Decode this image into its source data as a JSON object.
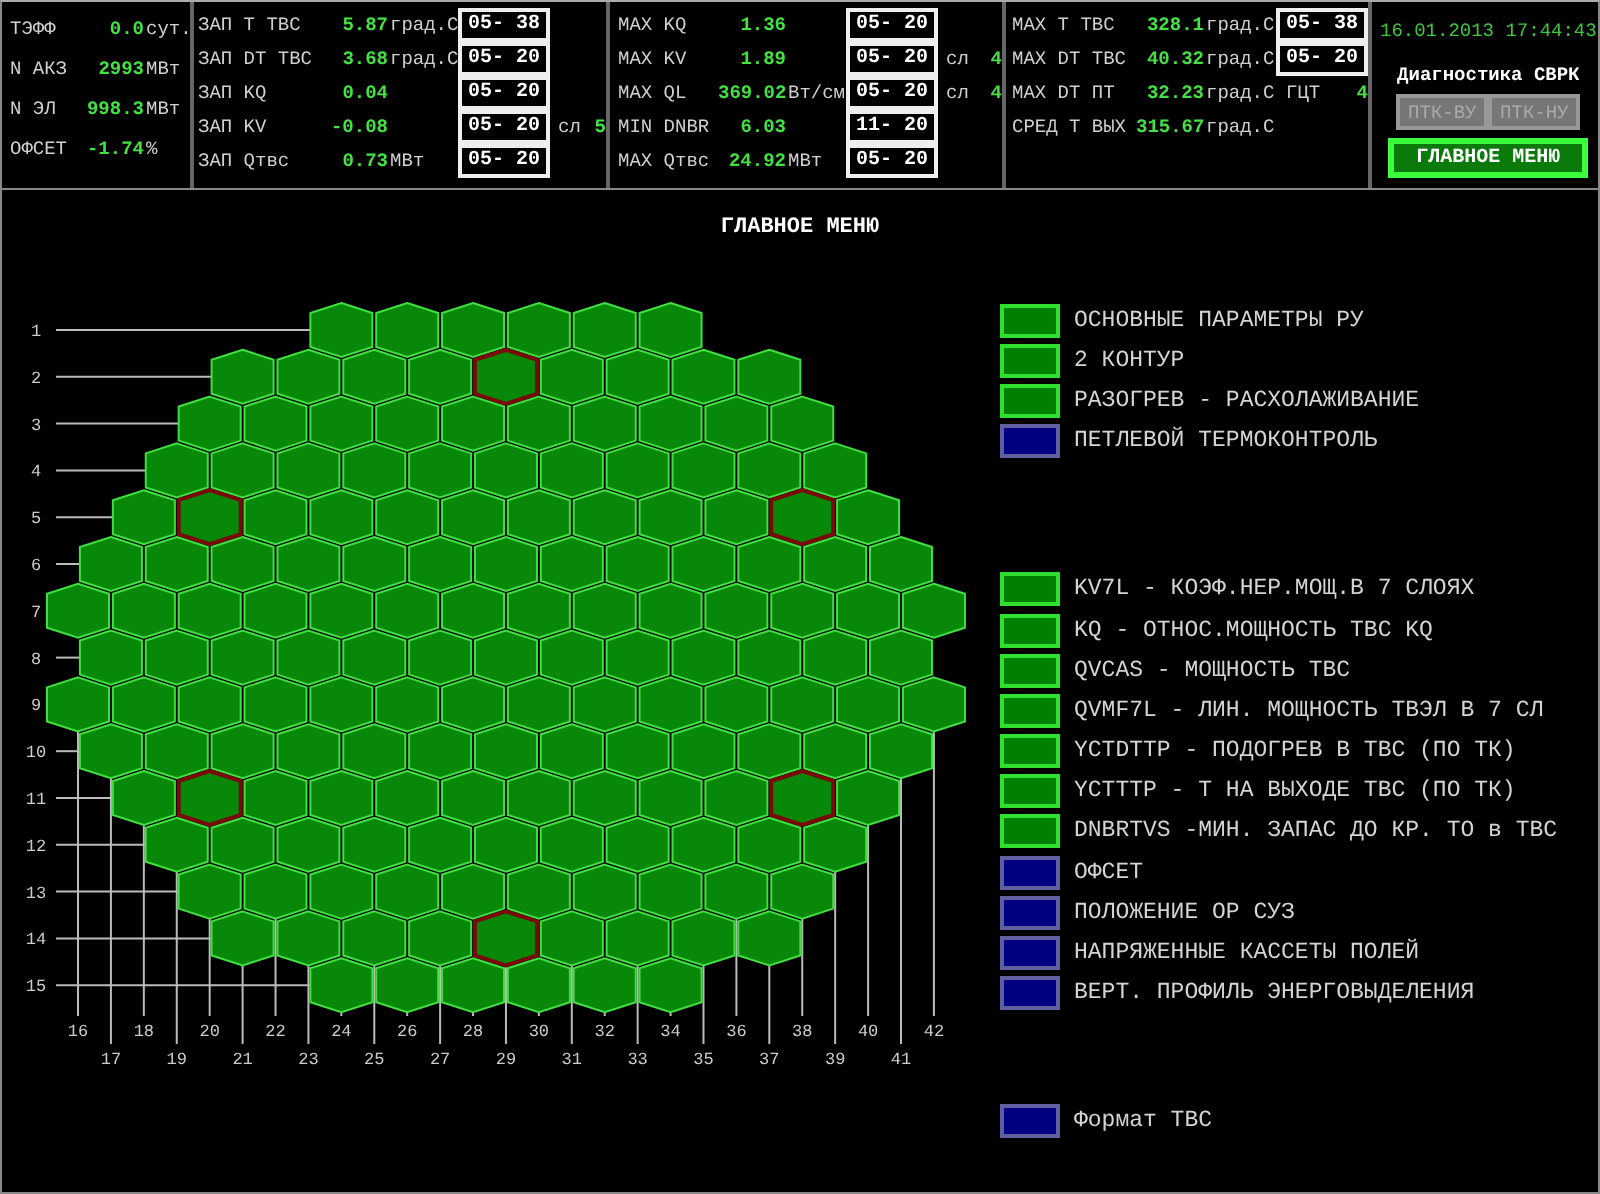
{
  "header": {
    "summary": [
      {
        "label": "ТЭФФ",
        "value": "0.0",
        "unit": "сут."
      },
      {
        "label": "N АКЗ",
        "value": "2993",
        "unit": "МВт"
      },
      {
        "label": "N ЭЛ",
        "value": "998.3",
        "unit": "МВт"
      },
      {
        "label": "ОФСЕТ",
        "value": "-1.74",
        "unit": "%"
      }
    ],
    "reserves": [
      {
        "label": "ЗАП Т ТВС",
        "value": "5.87",
        "unit": "град.С",
        "location": "05- 38"
      },
      {
        "label": "ЗАП DT ТВС",
        "value": "3.68",
        "unit": "град.С",
        "location": "05- 20"
      },
      {
        "label": "ЗАП KQ",
        "value": "0.04",
        "location": "05- 20"
      },
      {
        "label": "ЗАП KV",
        "value": "-0.08",
        "location": "05- 20",
        "layer_label": "сл",
        "layer": "5"
      },
      {
        "label": "ЗАП Qтвс",
        "value": "0.73",
        "unit": "МВт",
        "location": "05- 20"
      }
    ],
    "maxima": [
      {
        "label": "MAX KQ",
        "value": "1.36",
        "location": "05- 20"
      },
      {
        "label": "MAX KV",
        "value": "1.89",
        "location": "05- 20",
        "layer_label": "сл",
        "layer": "4"
      },
      {
        "label": "MAX QL",
        "value": "369.02",
        "unit": "Вт/см",
        "location": "05- 20",
        "layer_label": "сл",
        "layer": "4"
      },
      {
        "label": "MIN DNBR",
        "value": "6.03",
        "location": "11- 20"
      },
      {
        "label": "MAX Qтвс",
        "value": "24.92",
        "unit": "МВт",
        "location": "05- 20"
      }
    ],
    "temperatures": [
      {
        "label": "MAX Т ТВС",
        "value": "328.1",
        "unit": "град.С",
        "location": "05- 38"
      },
      {
        "label": "MAX DT ТВС",
        "value": "40.32",
        "unit": "град.С",
        "location": "05- 20"
      },
      {
        "label": "MAX DT ПТ",
        "value": "32.23",
        "unit": "град.С",
        "loop_label": "ГЦТ",
        "loop": "4"
      },
      {
        "label": "СРЕД Т ВЫХ",
        "value": "315.67",
        "unit": "град.С"
      }
    ],
    "datetime": "16.01.2013 17:44:43",
    "diagnostics_title": "Диагностика СВРК",
    "buttons": [
      {
        "label": "ПТК-ВУ",
        "disabled": true
      },
      {
        "label": "ПТК-НУ",
        "disabled": true
      }
    ],
    "main_menu_button": {
      "label": "ГЛАВНОЕ МЕНЮ",
      "selected": true
    }
  },
  "title": "ГЛАВНОЕ МЕНЮ",
  "core_map": {
    "rows": [
      {
        "label": "1",
        "cells": [
          {
            "marked": false
          },
          {
            "marked": false
          },
          {
            "marked": false
          },
          {
            "marked": false
          },
          {
            "marked": false
          },
          {
            "marked": false
          }
        ]
      },
      {
        "label": "2",
        "cells": [
          {
            "marked": false
          },
          {
            "marked": false
          },
          {
            "marked": false
          },
          {
            "marked": false
          },
          {
            "marked": true
          },
          {
            "marked": false
          },
          {
            "marked": false
          },
          {
            "marked": false
          },
          {
            "marked": false
          }
        ]
      },
      {
        "label": "3",
        "cells": [
          {
            "marked": false
          },
          {
            "marked": false
          },
          {
            "marked": false
          },
          {
            "marked": false
          },
          {
            "marked": false
          },
          {
            "marked": false
          },
          {
            "marked": false
          },
          {
            "marked": false
          },
          {
            "marked": false
          },
          {
            "marked": false
          }
        ]
      },
      {
        "label": "4",
        "cells": [
          {
            "marked": false
          },
          {
            "marked": false
          },
          {
            "marked": false
          },
          {
            "marked": false
          },
          {
            "marked": false
          },
          {
            "marked": false
          },
          {
            "marked": false
          },
          {
            "marked": false
          },
          {
            "marked": false
          },
          {
            "marked": false
          },
          {
            "marked": false
          }
        ]
      },
      {
        "label": "5",
        "cells": [
          {
            "marked": false
          },
          {
            "marked": true
          },
          {
            "marked": false
          },
          {
            "marked": false
          },
          {
            "marked": false
          },
          {
            "marked": false
          },
          {
            "marked": false
          },
          {
            "marked": false
          },
          {
            "marked": false
          },
          {
            "marked": false
          },
          {
            "marked": true
          },
          {
            "marked": false
          }
        ]
      },
      {
        "label": "6",
        "cells": [
          {
            "marked": false
          },
          {
            "marked": false
          },
          {
            "marked": false
          },
          {
            "marked": false
          },
          {
            "marked": false
          },
          {
            "marked": false
          },
          {
            "marked": false
          },
          {
            "marked": false
          },
          {
            "marked": false
          },
          {
            "marked": false
          },
          {
            "marked": false
          },
          {
            "marked": false
          },
          {
            "marked": false
          }
        ]
      },
      {
        "label": "7",
        "cells": [
          {
            "marked": false
          },
          {
            "marked": false
          },
          {
            "marked": false
          },
          {
            "marked": false
          },
          {
            "marked": false
          },
          {
            "marked": false
          },
          {
            "marked": false
          },
          {
            "marked": false
          },
          {
            "marked": false
          },
          {
            "marked": false
          },
          {
            "marked": false
          },
          {
            "marked": false
          },
          {
            "marked": false
          },
          {
            "marked": false
          }
        ]
      },
      {
        "label": "8",
        "cells": [
          {
            "marked": false
          },
          {
            "marked": false
          },
          {
            "marked": false
          },
          {
            "marked": false
          },
          {
            "marked": false
          },
          {
            "marked": false
          },
          {
            "marked": false
          },
          {
            "marked": false
          },
          {
            "marked": false
          },
          {
            "marked": false
          },
          {
            "marked": false
          },
          {
            "marked": false
          },
          {
            "marked": false
          }
        ]
      },
      {
        "label": "9",
        "cells": [
          {
            "marked": false
          },
          {
            "marked": false
          },
          {
            "marked": false
          },
          {
            "marked": false
          },
          {
            "marked": false
          },
          {
            "marked": false
          },
          {
            "marked": false
          },
          {
            "marked": false
          },
          {
            "marked": false
          },
          {
            "marked": false
          },
          {
            "marked": false
          },
          {
            "marked": false
          },
          {
            "marked": false
          },
          {
            "marked": false
          }
        ]
      },
      {
        "label": "10",
        "cells": [
          {
            "marked": false
          },
          {
            "marked": false
          },
          {
            "marked": false
          },
          {
            "marked": false
          },
          {
            "marked": false
          },
          {
            "marked": false
          },
          {
            "marked": false
          },
          {
            "marked": false
          },
          {
            "marked": false
          },
          {
            "marked": false
          },
          {
            "marked": false
          },
          {
            "marked": false
          },
          {
            "marked": false
          }
        ]
      },
      {
        "label": "11",
        "cells": [
          {
            "marked": false
          },
          {
            "marked": true
          },
          {
            "marked": false
          },
          {
            "marked": false
          },
          {
            "marked": false
          },
          {
            "marked": false
          },
          {
            "marked": false
          },
          {
            "marked": false
          },
          {
            "marked": false
          },
          {
            "marked": false
          },
          {
            "marked": true
          },
          {
            "marked": false
          }
        ]
      },
      {
        "label": "12",
        "cells": [
          {
            "marked": false
          },
          {
            "marked": false
          },
          {
            "marked": false
          },
          {
            "marked": false
          },
          {
            "marked": false
          },
          {
            "marked": false
          },
          {
            "marked": false
          },
          {
            "marked": false
          },
          {
            "marked": false
          },
          {
            "marked": false
          },
          {
            "marked": false
          }
        ]
      },
      {
        "label": "13",
        "cells": [
          {
            "marked": false
          },
          {
            "marked": false
          },
          {
            "marked": false
          },
          {
            "marked": false
          },
          {
            "marked": false
          },
          {
            "marked": false
          },
          {
            "marked": false
          },
          {
            "marked": false
          },
          {
            "marked": false
          },
          {
            "marked": false
          }
        ]
      },
      {
        "label": "14",
        "cells": [
          {
            "marked": false
          },
          {
            "marked": false
          },
          {
            "marked": false
          },
          {
            "marked": false
          },
          {
            "marked": true
          },
          {
            "marked": false
          },
          {
            "marked": false
          },
          {
            "marked": false
          },
          {
            "marked": false
          }
        ]
      },
      {
        "label": "15",
        "cells": [
          {
            "marked": false
          },
          {
            "marked": false
          },
          {
            "marked": false
          },
          {
            "marked": false
          },
          {
            "marked": false
          },
          {
            "marked": false
          }
        ]
      }
    ],
    "column_labels": [
      "16",
      "17",
      "18",
      "19",
      "20",
      "21",
      "22",
      "23",
      "24",
      "25",
      "26",
      "27",
      "28",
      "29",
      "30",
      "31",
      "32",
      "33",
      "34",
      "35",
      "36",
      "37",
      "38",
      "39",
      "40",
      "41",
      "42"
    ]
  },
  "menu": {
    "groups": [
      {
        "items": [
          {
            "label": "ОСНОВНЫЕ ПАРАМЕТРЫ РУ",
            "color": "#008000"
          },
          {
            "label": "2 КОНТУР",
            "color": "#008000"
          },
          {
            "label": "РАЗОГРЕВ - РАСХОЛАЖИВАНИЕ",
            "color": "#008000"
          },
          {
            "label": "ПЕТЛЕВОЙ ТЕРМОКОНТРОЛЬ",
            "color": "#000080"
          }
        ]
      },
      {
        "items": [
          {
            "label": "KV7L - КОЭФ.НЕР.МОЩ.В 7 СЛОЯХ",
            "color": "#008000"
          },
          {
            "label": "KQ - ОТНОС.МОЩНОСТЬ ТВС KQ",
            "color": "#008000"
          },
          {
            "label": "QVCAS - МОЩНОСТЬ ТВС",
            "color": "#008000"
          },
          {
            "label": "QVMF7L - ЛИН. МОЩНОСТЬ ТВЭЛ В 7 СЛ",
            "color": "#008000"
          },
          {
            "label": "YCTDTTP - ПОДОГРЕВ В ТВС (ПО ТК)",
            "color": "#008000"
          },
          {
            "label": "YCTTTP - Т НА ВЫХОДЕ ТВС (ПО ТК)",
            "color": "#008000"
          },
          {
            "label": "DNBRTVS -МИН. ЗАПАС ДО КР. ТО в ТВС",
            "color": "#008000"
          },
          {
            "label": "ОФСЕТ",
            "color": "#000080"
          },
          {
            "label": "ПОЛОЖЕНИЕ ОР СУЗ",
            "color": "#000080"
          },
          {
            "label": "НАПРЯЖЕННЫЕ КАССЕТЫ ПОЛЕЙ",
            "color": "#000080"
          },
          {
            "label": "ВЕРТ. ПРОФИЛЬ ЭНЕРГОВЫДЕЛЕНИЯ",
            "color": "#000080"
          }
        ]
      },
      {
        "items": [
          {
            "label": "Формат ТВС",
            "color": "#000080"
          }
        ]
      }
    ]
  }
}
